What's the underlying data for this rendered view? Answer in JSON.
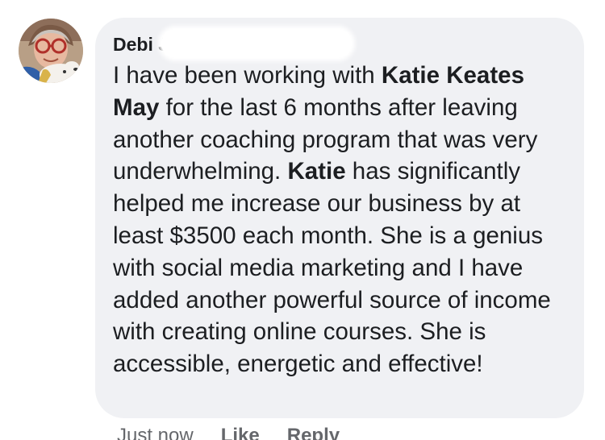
{
  "comment": {
    "author": "Debi J",
    "body_segments": [
      {
        "text": "I have been working with ",
        "bold": false
      },
      {
        "text": "Katie Keates May",
        "bold": true
      },
      {
        "text": " for the last 6 months after leaving another coaching program that was very underwhelming. ",
        "bold": false
      },
      {
        "text": "Katie",
        "bold": true
      },
      {
        "text": " has significantly helped me increase our business by at least $3500 each month. She is a genius with social media marketing and I have added another powerful source of income with creating online courses. She is accessible, energetic and effective!",
        "bold": false
      }
    ],
    "timestamp": "Just now",
    "like_label": "Like",
    "reply_label": "Reply"
  },
  "colors": {
    "bubble_background": "#f0f1f4",
    "text_primary": "#1c1e21",
    "text_secondary": "#65676b"
  },
  "icons": {
    "avatar": "user-profile-photo"
  }
}
